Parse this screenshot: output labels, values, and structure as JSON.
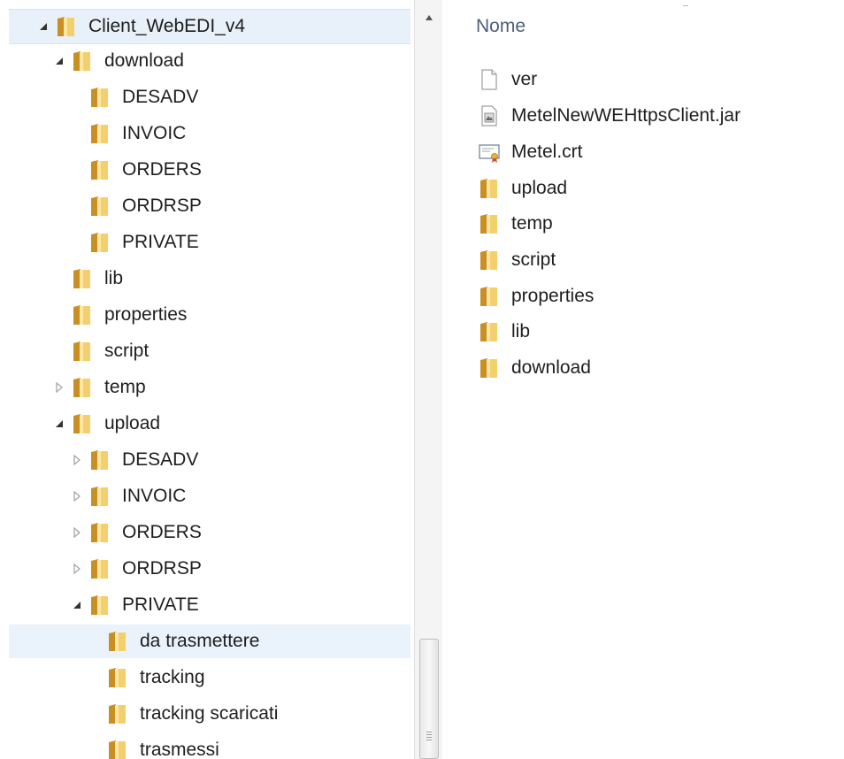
{
  "tree": {
    "items": [
      {
        "label": "Client_WebEDI_v4",
        "arrow": "expanded",
        "selected": true
      },
      {
        "label": "download",
        "arrow": "expanded"
      },
      {
        "label": "DESADV",
        "arrow": "none"
      },
      {
        "label": "INVOIC",
        "arrow": "none"
      },
      {
        "label": "ORDERS",
        "arrow": "none"
      },
      {
        "label": "ORDRSP",
        "arrow": "none"
      },
      {
        "label": "PRIVATE",
        "arrow": "none"
      },
      {
        "label": "lib",
        "arrow": "none"
      },
      {
        "label": "properties",
        "arrow": "none"
      },
      {
        "label": "script",
        "arrow": "none"
      },
      {
        "label": "temp",
        "arrow": "collapsed"
      },
      {
        "label": "upload",
        "arrow": "expanded"
      },
      {
        "label": "DESADV",
        "arrow": "collapsed"
      },
      {
        "label": "INVOIC",
        "arrow": "collapsed"
      },
      {
        "label": "ORDERS",
        "arrow": "collapsed"
      },
      {
        "label": "ORDRSP",
        "arrow": "collapsed"
      },
      {
        "label": "PRIVATE",
        "arrow": "expanded"
      },
      {
        "label": "da trasmettere",
        "arrow": "none",
        "hover": true
      },
      {
        "label": "tracking",
        "arrow": "none"
      },
      {
        "label": "tracking scaricati",
        "arrow": "none"
      },
      {
        "label": "trasmessi",
        "arrow": "none"
      }
    ]
  },
  "content": {
    "column_header": "Nome",
    "files": [
      {
        "name": "ver",
        "icon": "blank-file-icon"
      },
      {
        "name": "MetelNewWEHttpsClient.jar",
        "icon": "jar-file-icon"
      },
      {
        "name": "Metel.crt",
        "icon": "certificate-icon"
      },
      {
        "name": "upload",
        "icon": "folder-icon"
      },
      {
        "name": "temp",
        "icon": "folder-icon"
      },
      {
        "name": "script",
        "icon": "folder-icon"
      },
      {
        "name": "properties",
        "icon": "folder-icon"
      },
      {
        "name": "lib",
        "icon": "folder-icon"
      },
      {
        "name": "download",
        "icon": "folder-icon"
      }
    ]
  },
  "colors": {
    "folder_back": "#d8a93b",
    "folder_front": "#f6d780",
    "selected_bg": "#e8f0fa",
    "header_text": "#4c607a"
  }
}
